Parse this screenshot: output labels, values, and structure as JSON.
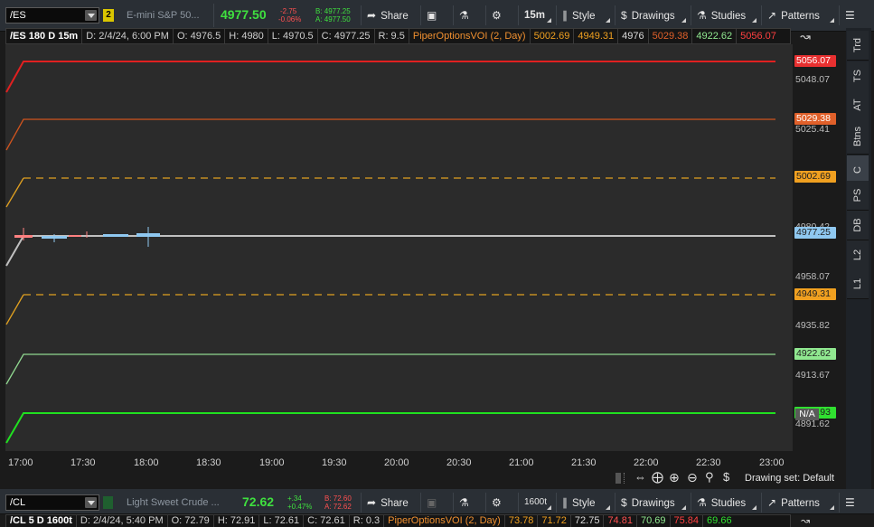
{
  "top": {
    "symbol": "/ES",
    "link_badge": "2",
    "description": "E-mini S&P 50...",
    "last": "4977.50",
    "net_change": "-2.75",
    "pct_change": "-0.06%",
    "bid": "B: 4977.25",
    "ask": "A: 4977.50",
    "share_label": "Share",
    "timeframe": "15m",
    "style_label": "Style",
    "drawings_label": "Drawings",
    "studies_label": "Studies",
    "patterns_label": "Patterns"
  },
  "info": {
    "title": "/ES 180 D 15m",
    "date": "D: 2/4/24, 6:00 PM",
    "open": "O: 4976.5",
    "high": "H: 4980",
    "low": "L: 4970.5",
    "close": "C: 4977.25",
    "range": "R: 9.5",
    "study": "PiperOptionsVOI (2, Day)",
    "v1": "5002.69",
    "v2": "4949.31",
    "v3": "4976",
    "v4": "5029.38",
    "v5": "4922.62",
    "v6": "5056.07"
  },
  "yaxis": {
    "ticks": [
      "5048.07",
      "5025.41",
      "4980.42",
      "4958.07",
      "4935.82",
      "4913.67",
      "4891.62"
    ],
    "markers": [
      {
        "label": "5056.07",
        "bg": "#e83030",
        "fg": "#ffffff"
      },
      {
        "label": "5029.38",
        "bg": "#e0602a",
        "fg": "#ffffff"
      },
      {
        "label": "5002.69",
        "bg": "#f0a020",
        "fg": "#202020"
      },
      {
        "label": "4977.25",
        "bg": "#8fc8f0",
        "fg": "#202020"
      },
      {
        "label": "4949.31",
        "bg": "#f0a020",
        "fg": "#202020"
      },
      {
        "label": "4922.62",
        "bg": "#90e890",
        "fg": "#202020"
      },
      {
        "label": "4891.93",
        "bg": "#30e030",
        "fg": "#202020"
      }
    ],
    "na_label": "N/A"
  },
  "xaxis": {
    "ticks": [
      "17:00",
      "17:30",
      "18:00",
      "18:30",
      "19:00",
      "19:30",
      "20:00",
      "20:30",
      "21:00",
      "21:30",
      "22:00",
      "22:30",
      "23:00"
    ]
  },
  "footer": {
    "drawing_set": "Drawing set: Default"
  },
  "right_tabs": [
    "Trd",
    "TS",
    "AT",
    "Btns",
    "C",
    "PS",
    "DB",
    "L2",
    "L1"
  ],
  "bottom": {
    "symbol": "/CL",
    "description": "Light Sweet Crude ...",
    "last": "72.62",
    "net_change": "+.34",
    "pct_change": "+0.47%",
    "bid": "B: 72.60",
    "ask": "A: 72.62",
    "share_label": "Share",
    "timeframe": "1600t",
    "style_label": "Style",
    "drawings_label": "Drawings",
    "studies_label": "Studies",
    "patterns_label": "Patterns",
    "info_title": "/CL 5 D 1600t",
    "info_date": "D: 2/4/24, 5:40 PM",
    "info_open": "O: 72.79",
    "info_high": "H: 72.91",
    "info_low": "L: 72.61",
    "info_close": "C: 72.61",
    "info_range": "R: 0.3",
    "info_study": "PiperOptionsVOI (2, Day)",
    "b1": "73.78",
    "b2": "71.72",
    "b3": "72.75",
    "b4": "74.81",
    "b5": "70.69",
    "b6": "75.84",
    "b7": "69.66"
  },
  "colors": {
    "line_red": "#e02020",
    "line_orange": "#d0541e",
    "line_yellow_dash": "#e0a020",
    "line_gray": "#c0c0c0",
    "line_lightgreen": "#90d890",
    "line_green": "#20e020",
    "up_color": "#3fe03f",
    "down_color": "#ff5050"
  }
}
